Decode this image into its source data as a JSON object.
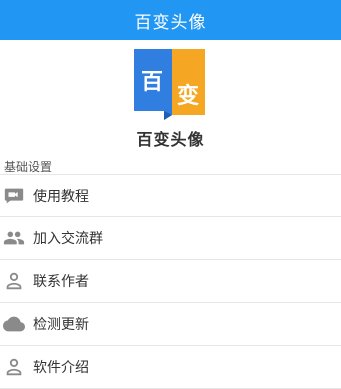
{
  "titlebar": {
    "title": "百变头像",
    "background": "#2196F3"
  },
  "logo": {
    "char_1": "百",
    "char_2": "变",
    "color_left": "#2F7EE0",
    "color_right": "#F5A623"
  },
  "app": {
    "name": "百变头像"
  },
  "section": {
    "title": "基础设置"
  },
  "menu": [
    {
      "label": "使用教程",
      "icon": "video-camera-icon"
    },
    {
      "label": "加入交流群",
      "icon": "group-icon"
    },
    {
      "label": "联系作者",
      "icon": "person-icon"
    },
    {
      "label": "检测更新",
      "icon": "cloud-icon"
    },
    {
      "label": "软件介绍",
      "icon": "person-icon"
    }
  ],
  "colors": {
    "icon_gray": "#8a8a8a",
    "divider": "#e6e6e6"
  }
}
